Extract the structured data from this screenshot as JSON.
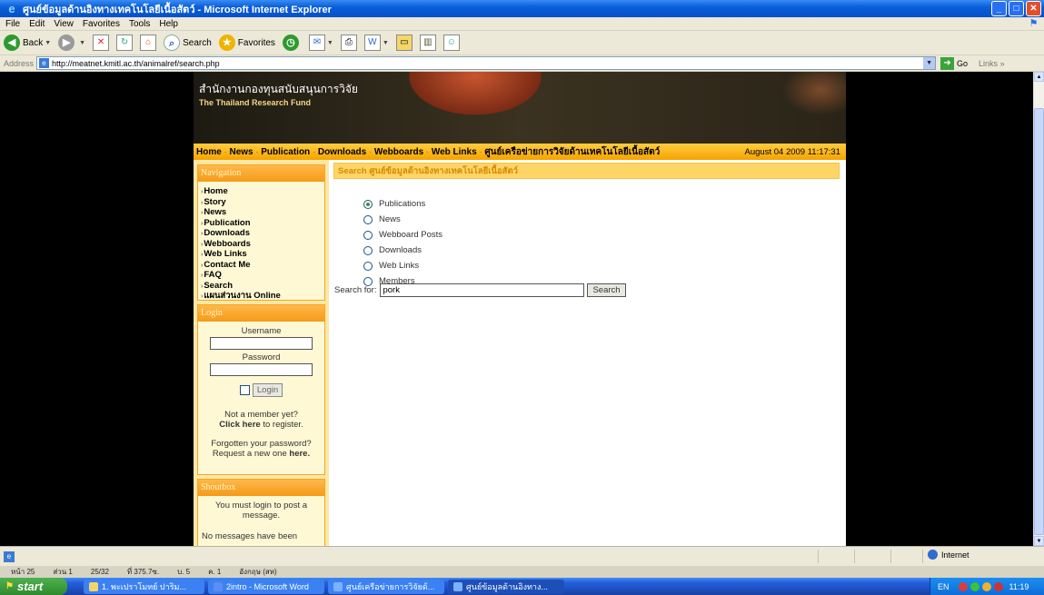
{
  "window": {
    "title": "ศูนย์ข้อมูลด้านอิงทางเทคโนโลยีเนื้อสัตว์ - Microsoft Internet Explorer"
  },
  "menu": [
    "File",
    "Edit",
    "View",
    "Favorites",
    "Tools",
    "Help"
  ],
  "toolbar": {
    "back": "Back",
    "search": "Search",
    "favorites": "Favorites"
  },
  "address": {
    "label": "Address",
    "url": "http://meatnet.kmitl.ac.th/animalref/search.php",
    "go": "Go",
    "links": "Links"
  },
  "banner": {
    "thai": "สำนักงานกองทุนสนับสนุนการวิจัย",
    "english": "The Thailand Research Fund"
  },
  "topnav": {
    "items": [
      "Home",
      "News",
      "Publication",
      "Downloads",
      "Webboards",
      "Web Links",
      "ศูนย์เครือข่ายการวิจัยด้านเทคโนโลยีเนื้อสัตว์"
    ],
    "datetime": "August 04 2009 11:17:31"
  },
  "navigation": {
    "title": "Navigation",
    "items": [
      "Home",
      "Story",
      "News",
      "Publication",
      "Downloads",
      "Webboards",
      "Web Links",
      "Contact Me",
      "FAQ",
      "Search",
      "แผนส่วนงาน Online"
    ]
  },
  "login": {
    "title": "Login",
    "username_label": "Username",
    "password_label": "Password",
    "button": "Login",
    "not_member": "Not a member yet?",
    "click_here": "Click here",
    "to_register": " to register.",
    "forgot": "Forgotten your password?",
    "request": "Request a new one ",
    "here": "here."
  },
  "shoutbox": {
    "title": "Shoutbox",
    "message": "You must login to post a message.",
    "no_messages": "No messages have been"
  },
  "search": {
    "header": "Search ศูนย์ข้อมูลด้านอิงทางเทคโนโลยีเนื้อสัตว์",
    "options": [
      "Publications",
      "News",
      "Webboard Posts",
      "Downloads",
      "Web Links",
      "Members"
    ],
    "selected_index": 0,
    "label": "Search for:",
    "value": "pork",
    "button": "Search"
  },
  "status": {
    "zone": "Internet"
  },
  "wordbar": [
    "หน้า 25",
    "ส่วน 1",
    "25/32",
    "ที่ 375.7ซ.",
    "บ. 5",
    "ค. 1",
    "อังกฤษ (สห)"
  ],
  "taskbar": {
    "start": "start",
    "tasks": [
      "1. พะเปราโมทย์ ปาริม...",
      "2intro - Microsoft Word",
      "ศูนย์เครือข่ายการวิจัยด้...",
      "ศูนย์ข้อมูลด้านอิงทาง..."
    ],
    "tray_lang": "EN",
    "clock": "11:19"
  }
}
